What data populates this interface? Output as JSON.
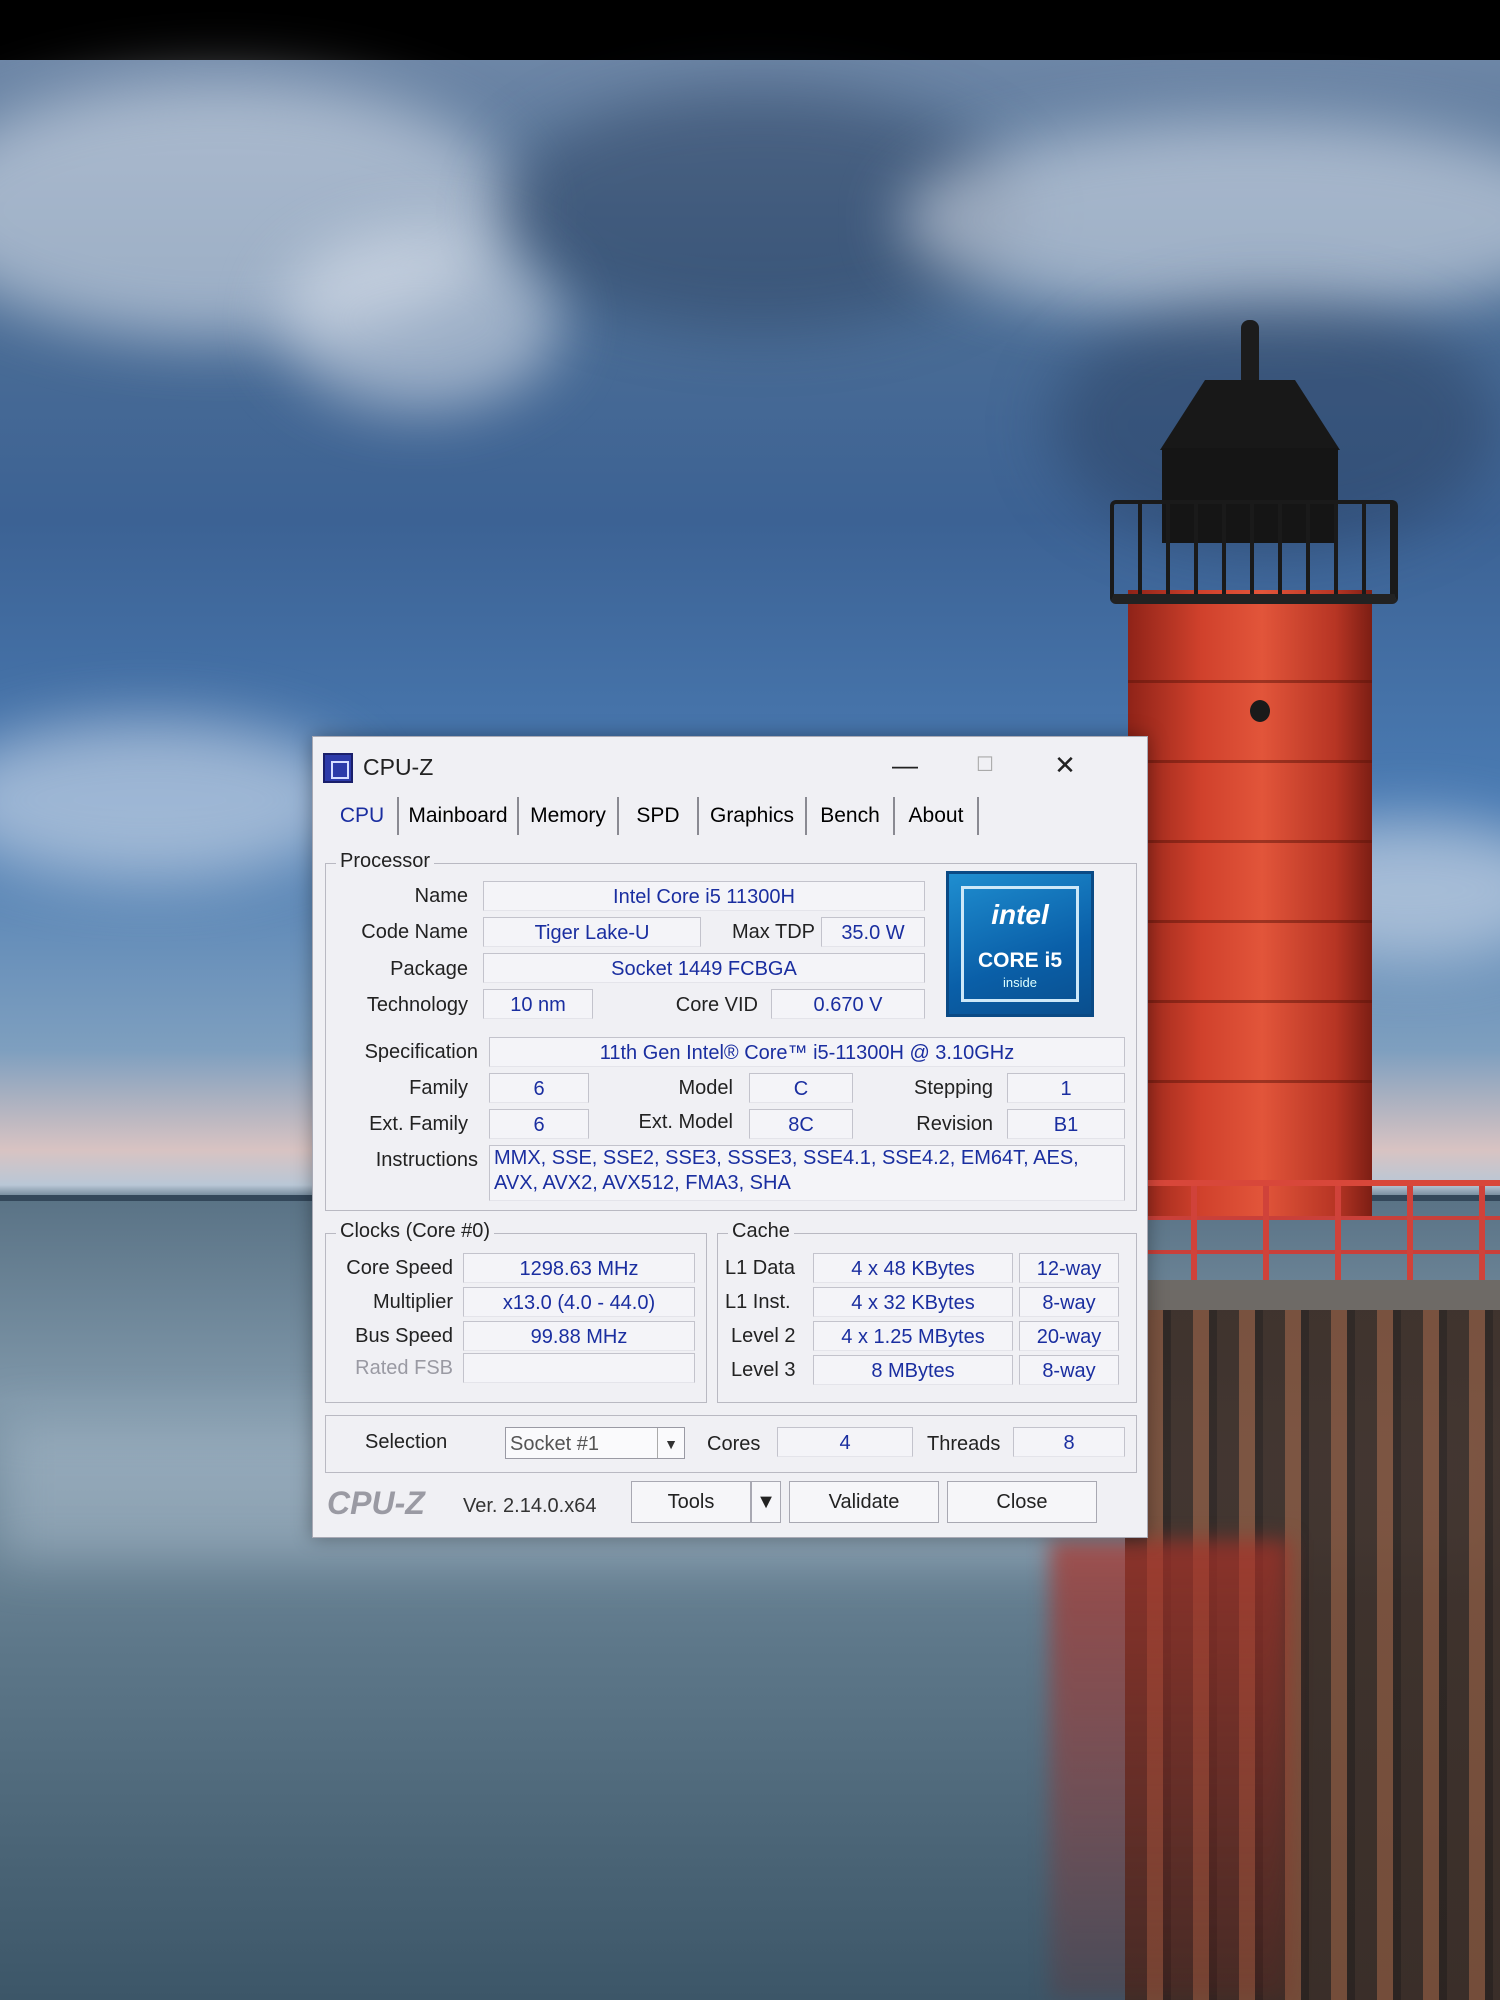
{
  "window": {
    "title": "CPU-Z",
    "controls": {
      "minimize": "—",
      "maximize": "☐",
      "close": "✕"
    }
  },
  "tabs": [
    "CPU",
    "Mainboard",
    "Memory",
    "SPD",
    "Graphics",
    "Bench",
    "About"
  ],
  "active_tab": "CPU",
  "processor": {
    "group_label": "Processor",
    "name_label": "Name",
    "name": "Intel Core i5 11300H",
    "code_name_label": "Code Name",
    "code_name": "Tiger Lake-U",
    "max_tdp_label": "Max TDP",
    "max_tdp": "35.0 W",
    "package_label": "Package",
    "package": "Socket 1449 FCBGA",
    "technology_label": "Technology",
    "technology": "10 nm",
    "core_vid_label": "Core VID",
    "core_vid": "0.670 V",
    "specification_label": "Specification",
    "specification": "11th Gen Intel® Core™ i5-11300H @ 3.10GHz",
    "family_label": "Family",
    "family": "6",
    "model_label": "Model",
    "model": "C",
    "stepping_label": "Stepping",
    "stepping": "1",
    "ext_family_label": "Ext. Family",
    "ext_family": "6",
    "ext_model_label": "Ext. Model",
    "ext_model": "8C",
    "revision_label": "Revision",
    "revision": "B1",
    "instructions_label": "Instructions",
    "instructions": "MMX, SSE, SSE2, SSE3, SSSE3, SSE4.1, SSE4.2, EM64T, AES, AVX, AVX2, AVX512, FMA3, SHA"
  },
  "logo": {
    "brand": "intel",
    "line": "CORE i5",
    "tag": "inside"
  },
  "clocks": {
    "group_label": "Clocks (Core #0)",
    "core_speed_label": "Core Speed",
    "core_speed": "1298.63 MHz",
    "multiplier_label": "Multiplier",
    "multiplier": "x13.0 (4.0 - 44.0)",
    "bus_speed_label": "Bus Speed",
    "bus_speed": "99.88 MHz",
    "rated_fsb_label": "Rated FSB",
    "rated_fsb": ""
  },
  "cache": {
    "group_label": "Cache",
    "rows": [
      {
        "label": "L1 Data",
        "size": "4 x 48 KBytes",
        "ways": "12-way"
      },
      {
        "label": "L1 Inst.",
        "size": "4 x 32 KBytes",
        "ways": "8-way"
      },
      {
        "label": "Level 2",
        "size": "4 x 1.25 MBytes",
        "ways": "20-way"
      },
      {
        "label": "Level 3",
        "size": "8 MBytes",
        "ways": "8-way"
      }
    ]
  },
  "selection": {
    "label": "Selection",
    "value": "Socket #1",
    "cores_label": "Cores",
    "cores": "4",
    "threads_label": "Threads",
    "threads": "8"
  },
  "footer": {
    "logo": "CPU-Z",
    "version": "Ver. 2.14.0.x64",
    "tools": "Tools",
    "validate": "Validate",
    "close": "Close"
  }
}
